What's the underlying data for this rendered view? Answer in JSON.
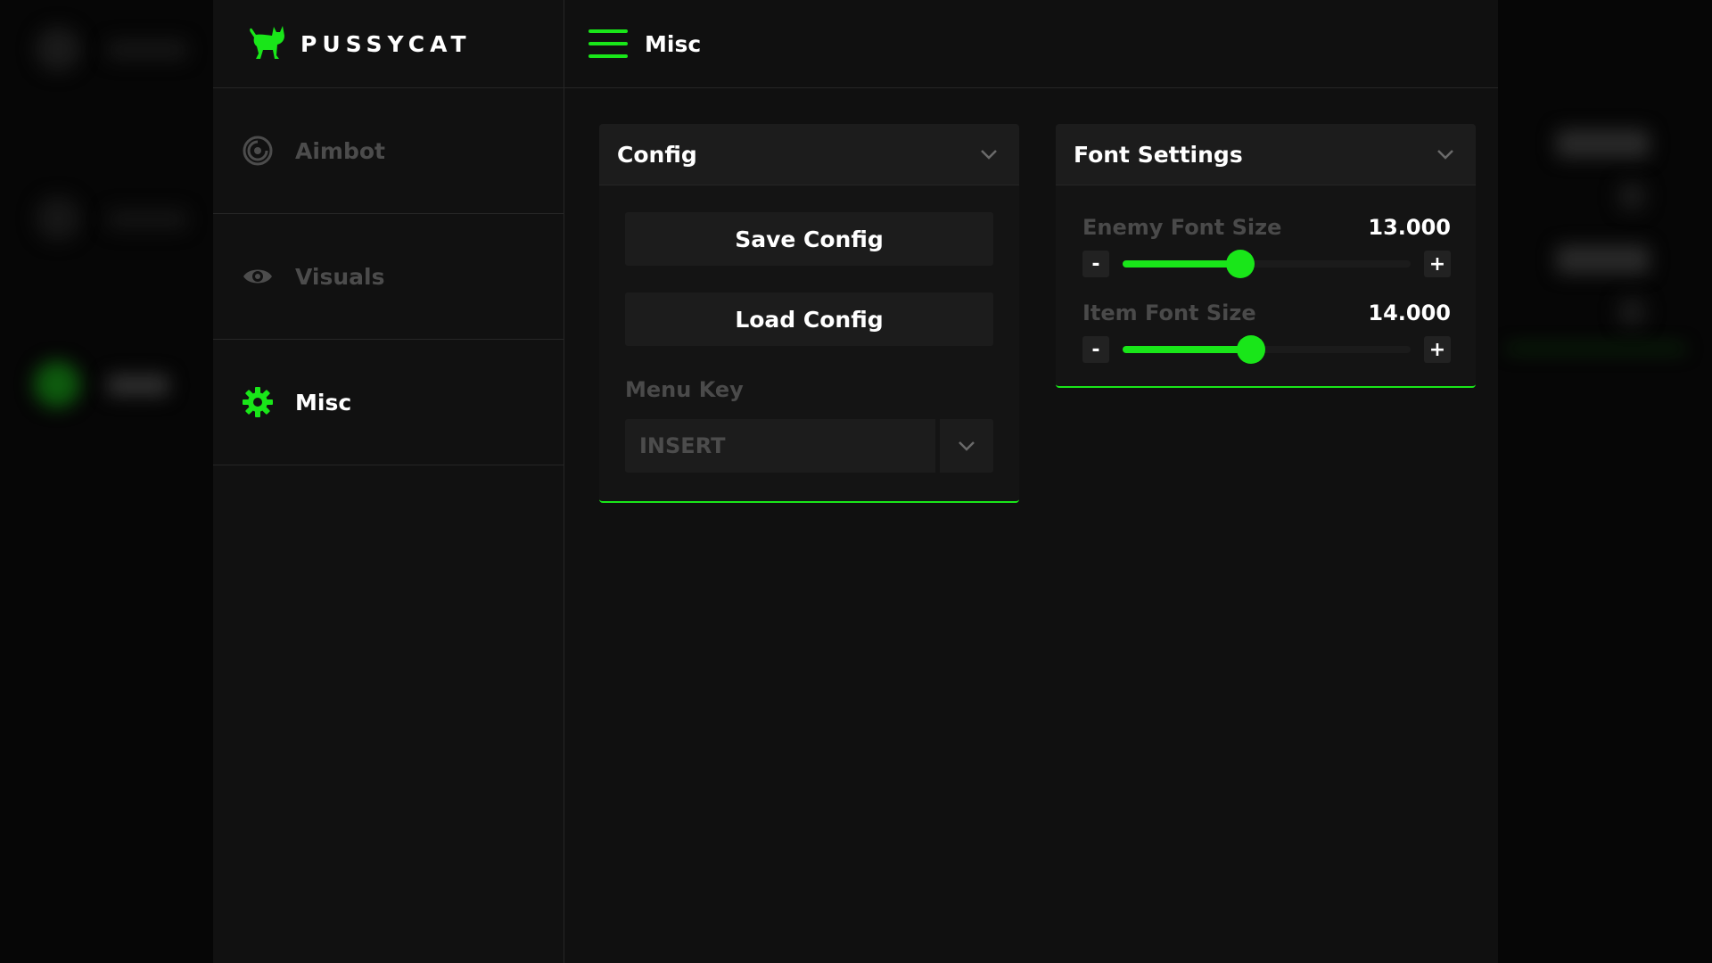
{
  "brand": {
    "name": "PUSSYCAT",
    "icon": "cat-icon"
  },
  "colors": {
    "accent": "#19e619",
    "panel": "#141414",
    "muted": "#4c4c4c"
  },
  "sidebar": {
    "items": [
      {
        "label": "Aimbot",
        "icon": "target-icon",
        "active": false
      },
      {
        "label": "Visuals",
        "icon": "eye-icon",
        "active": false
      },
      {
        "label": "Misc",
        "icon": "gear-icon",
        "active": true
      }
    ]
  },
  "header": {
    "title": "Misc",
    "icon": "hamburger-icon"
  },
  "config_panel": {
    "title": "Config",
    "save_label": "Save Config",
    "load_label": "Load Config",
    "menu_key_label": "Menu Key",
    "menu_key_value": "INSERT"
  },
  "font_panel": {
    "title": "Font Settings",
    "sliders": [
      {
        "label": "Enemy Font Size",
        "value": "13.000",
        "fraction": 0.41
      },
      {
        "label": "Item Font Size",
        "value": "14.000",
        "fraction": 0.447
      }
    ],
    "minus": "-",
    "plus": "+"
  }
}
